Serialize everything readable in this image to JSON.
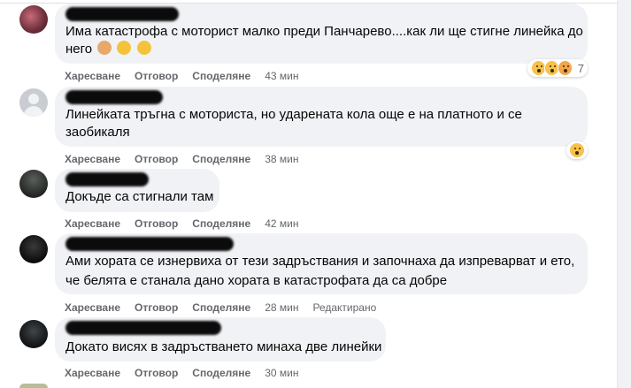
{
  "actions": {
    "like": "Харесване",
    "reply": "Отговор",
    "share": "Споделяне",
    "edited": "Редактирано"
  },
  "comments": [
    {
      "text_lines": [
        "Има катастрофа с моторист малко преди Панчарево....как ли ще стигне линейка до",
        "него"
      ],
      "time": "43 мин",
      "reaction_count": "7",
      "emojis": [
        "woman-facepalming",
        "worried-face",
        "disappointed-face"
      ]
    },
    {
      "text_lines": [
        "Линейката тръгна с моториста, но ударената кола още е на платното и се",
        "заобикаля"
      ],
      "time": "38 мин"
    },
    {
      "text_lines": [
        "Докъде са стигнали там"
      ],
      "time": "42 мин"
    },
    {
      "text_lines": [
        "Ами хората се изнервиха от тези задръствания и започнаха да изпреварват и ето,",
        "че белята е станала дано хората в катастрофата да са добре"
      ],
      "time": "28 мин",
      "edited": true
    },
    {
      "text_lines": [
        "Докато висях в задръстването минаха две линейки"
      ],
      "time": "30 мин"
    }
  ]
}
